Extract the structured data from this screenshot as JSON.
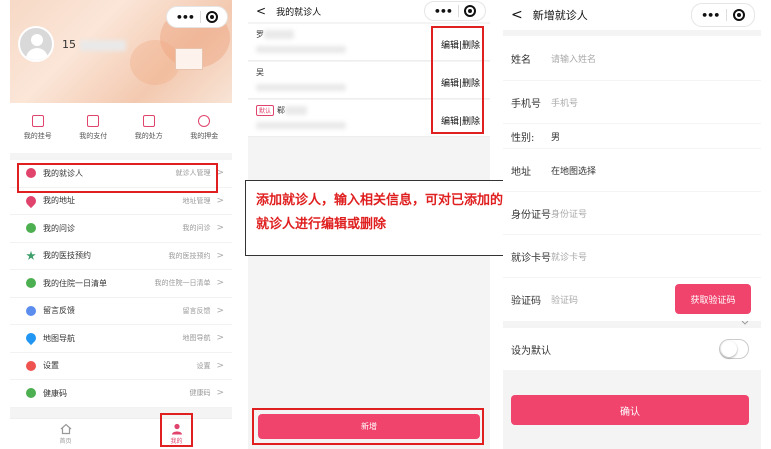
{
  "panel1": {
    "username_prefix": "15",
    "quick_actions": [
      {
        "label": "我的挂号",
        "icon": "registration-icon"
      },
      {
        "label": "我的支付",
        "icon": "payment-icon"
      },
      {
        "label": "我的处方",
        "icon": "prescription-icon"
      },
      {
        "label": "我的押金",
        "icon": "deposit-icon"
      }
    ],
    "menu": [
      {
        "label": "我的就诊人",
        "right": "就诊人管理",
        "icon": "patient-icon",
        "color": "#e0436b"
      },
      {
        "label": "我的地址",
        "right": "地址管理",
        "icon": "location-icon",
        "color": "#e0436b"
      },
      {
        "label": "我的问诊",
        "right": "我的问诊",
        "icon": "consult-icon",
        "color": "#4caf50"
      },
      {
        "label": "我的医技预约",
        "right": "我的医技预约",
        "icon": "star-icon",
        "color": "#3f9e6b"
      },
      {
        "label": "我的住院一日清单",
        "right": "我的住院一日清单",
        "icon": "chat-icon",
        "color": "#4caf50"
      },
      {
        "label": "留言反馈",
        "right": "留言反馈",
        "icon": "feedback-icon",
        "color": "#5b8def"
      },
      {
        "label": "地图导航",
        "right": "地图导航",
        "icon": "map-icon",
        "color": "#2196f3"
      },
      {
        "label": "设置",
        "right": "设置",
        "icon": "settings-icon",
        "color": "#ef5350"
      },
      {
        "label": "健康码",
        "right": "健康码",
        "icon": "health-code-icon",
        "color": "#4caf50"
      }
    ],
    "tabs": [
      {
        "label": "首页",
        "icon": "home-icon"
      },
      {
        "label": "我的",
        "icon": "profile-icon"
      }
    ],
    "chevron": ">"
  },
  "panel2": {
    "title": "我的就诊人",
    "back": "<",
    "patients": [
      {
        "name": "罗",
        "badge": "",
        "action": "编辑|删除"
      },
      {
        "name": "吴",
        "badge": "",
        "action": "编辑|删除"
      },
      {
        "name": "郗",
        "badge": "默认",
        "action": "编辑|删除"
      }
    ],
    "callout": "添加就诊人，输入相关信息，可对已添加的就诊人进行编辑或删除",
    "add_label": "新增"
  },
  "panel3": {
    "title": "新增就诊人",
    "back": "<",
    "fields": {
      "name_label": "姓名",
      "name_placeholder": "请输入姓名",
      "phone_label": "手机号",
      "phone_placeholder": "手机号",
      "gender_label": "性别:",
      "gender_value": "男",
      "address_label": "地址",
      "address_value": "在地图选择",
      "id_label": "身份证号",
      "id_placeholder": "身份证号",
      "card_label": "就诊卡号",
      "card_placeholder": "就诊卡号",
      "code_label": "验证码",
      "code_placeholder": "验证码",
      "code_button": "获取验证码",
      "default_label": "设为默认",
      "default_on": false
    },
    "confirm_label": "确认"
  },
  "capsule": {
    "dots": "•••"
  },
  "colors": {
    "accent": "#f0446d",
    "highlight": "#e02020"
  }
}
